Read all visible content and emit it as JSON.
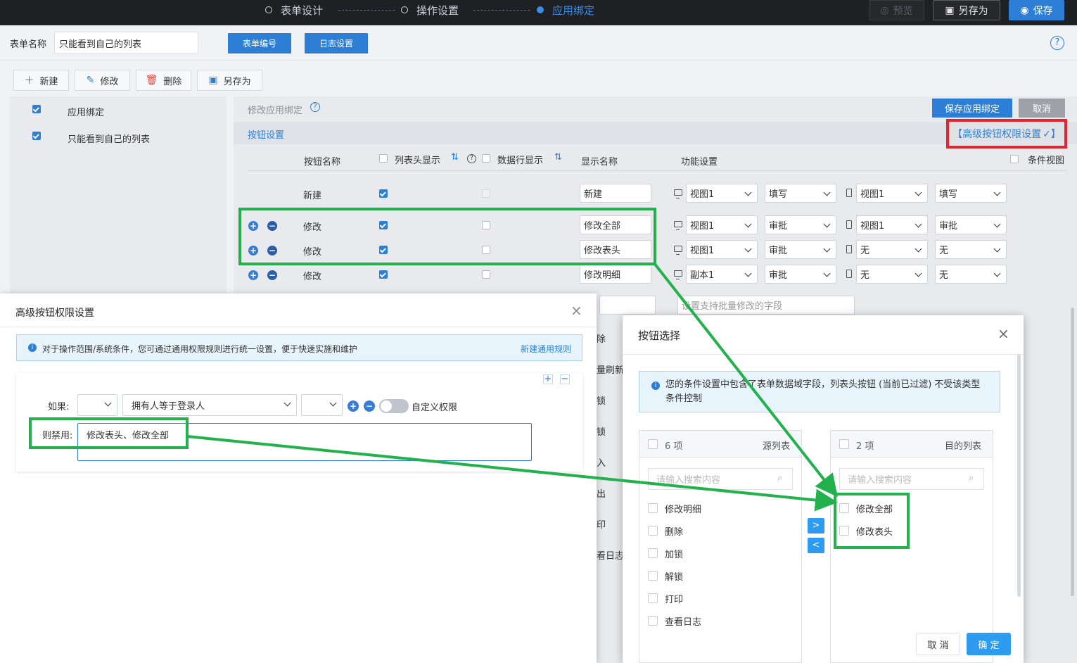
{
  "topbar": {
    "steps": [
      "表单设计",
      "操作设置",
      "应用绑定"
    ],
    "preview": "预览",
    "save_as": "另存为",
    "save": "保存"
  },
  "form": {
    "name_label": "表单名称",
    "name_value": "只能看到自己的列表",
    "btn_number": "表单编号",
    "btn_log": "日志设置",
    "help": "?"
  },
  "toolbar": {
    "new": "新建",
    "edit": "修改",
    "delete": "删除",
    "save_as": "另存为"
  },
  "left_list": [
    {
      "label": "应用绑定",
      "checked": true
    },
    {
      "label": "只能看到自己的列表",
      "checked": true
    }
  ],
  "right": {
    "edit_binding": "修改应用绑定",
    "save_binding": "保存应用绑定",
    "cancel": "取消",
    "button_settings": "按钮设置",
    "advanced": "【高级按钮权限设置",
    "headers": {
      "button_name": "按钮名称",
      "header_show": "列表头显示",
      "row_show": "数据行显示",
      "display_name": "显示名称",
      "function": "功能设置",
      "condition_view": "条件视图"
    },
    "rows": [
      {
        "name": "新建",
        "header": true,
        "row": false,
        "row_disabled": true,
        "display": "新建",
        "v1": "视图1",
        "a1": "填写",
        "v2": "视图1",
        "a2": "填写",
        "ctrl": false
      },
      {
        "name": "修改",
        "header": true,
        "row": false,
        "display": "修改全部",
        "v1": "视图1",
        "a1": "审批",
        "v2": "视图1",
        "a2": "审批",
        "ctrl": true
      },
      {
        "name": "修改",
        "header": true,
        "row": false,
        "display": "修改表头",
        "v1": "视图1",
        "a1": "审批",
        "v2": "无",
        "a2": "无",
        "ctrl": true
      },
      {
        "name": "修改",
        "header": true,
        "row": false,
        "display": "修改明细",
        "v1": "副本1",
        "a1": "审批",
        "v2": "无",
        "a2": "无",
        "ctrl": true
      }
    ],
    "batch_placeholder": "设置支持批量修改的字段",
    "partial_labels": [
      "除",
      "量刷新",
      "锁",
      "锁",
      "入",
      "出",
      "印",
      "看日志"
    ]
  },
  "dialog1": {
    "title": "高级按钮权限设置",
    "info": "对于操作范围/系统条件，您可通过通用权限规则进行统一设置，便于快速实施和维护",
    "new_rule": "新建通用规则",
    "if_label": "如果:",
    "condition": "拥有人等于登录人",
    "custom": "自定义权限",
    "disable_label": "则禁用:",
    "disable_value": "修改表头、修改全部"
  },
  "dialog2": {
    "title": "按钮选择",
    "info": "您的条件设置中包含了表单数据域字段，列表头按钮 (当前已过滤) 不受该类型条件控制",
    "source": {
      "count": "6 项",
      "title": "源列表",
      "search": "请输入搜索内容",
      "items": [
        "修改明细",
        "删除",
        "加锁",
        "解锁",
        "打印",
        "查看日志"
      ]
    },
    "target": {
      "count": "2 项",
      "title": "目的列表",
      "search": "请输入搜索内容",
      "items": [
        "修改全部",
        "修改表头"
      ]
    },
    "cancel": "取 消",
    "ok": "确 定"
  },
  "colors": {
    "accent": "#2d7fd6",
    "annotation_green": "#22b14c",
    "annotation_red": "#e8232d"
  }
}
